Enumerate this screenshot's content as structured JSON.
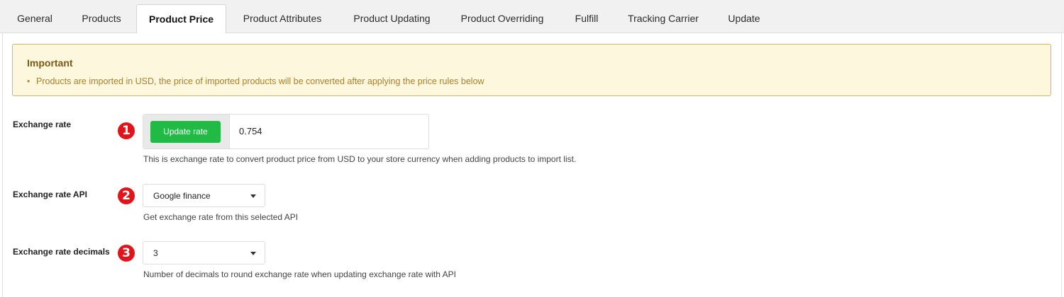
{
  "tabs": [
    {
      "label": "General"
    },
    {
      "label": "Products"
    },
    {
      "label": "Product Price"
    },
    {
      "label": "Product Attributes"
    },
    {
      "label": "Product Updating"
    },
    {
      "label": "Product Overriding"
    },
    {
      "label": "Fulfill"
    },
    {
      "label": "Tracking Carrier"
    },
    {
      "label": "Update"
    }
  ],
  "active_tab": "Product Price",
  "notice": {
    "title": "Important",
    "bullet": "•",
    "text": "Products are imported in USD, the price of imported products will be converted after applying the price rules below"
  },
  "exchange_rate": {
    "label": "Exchange rate",
    "badge": "1",
    "button_label": "Update rate",
    "value": "0.754",
    "help": "This is exchange rate to convert product price from USD to your store currency when adding products to import list."
  },
  "exchange_rate_api": {
    "label": "Exchange rate API",
    "badge": "2",
    "selected": "Google finance",
    "help": "Get exchange rate from this selected API"
  },
  "exchange_rate_decimals": {
    "label": "Exchange rate decimals",
    "badge": "3",
    "selected": "3",
    "help": "Number of decimals to round exchange rate when updating exchange rate with API"
  },
  "colors": {
    "accent_green": "#21ba45",
    "badge_red": "#e0141a",
    "notice_bg": "#fdf8dd",
    "notice_border": "#cbb96a"
  }
}
